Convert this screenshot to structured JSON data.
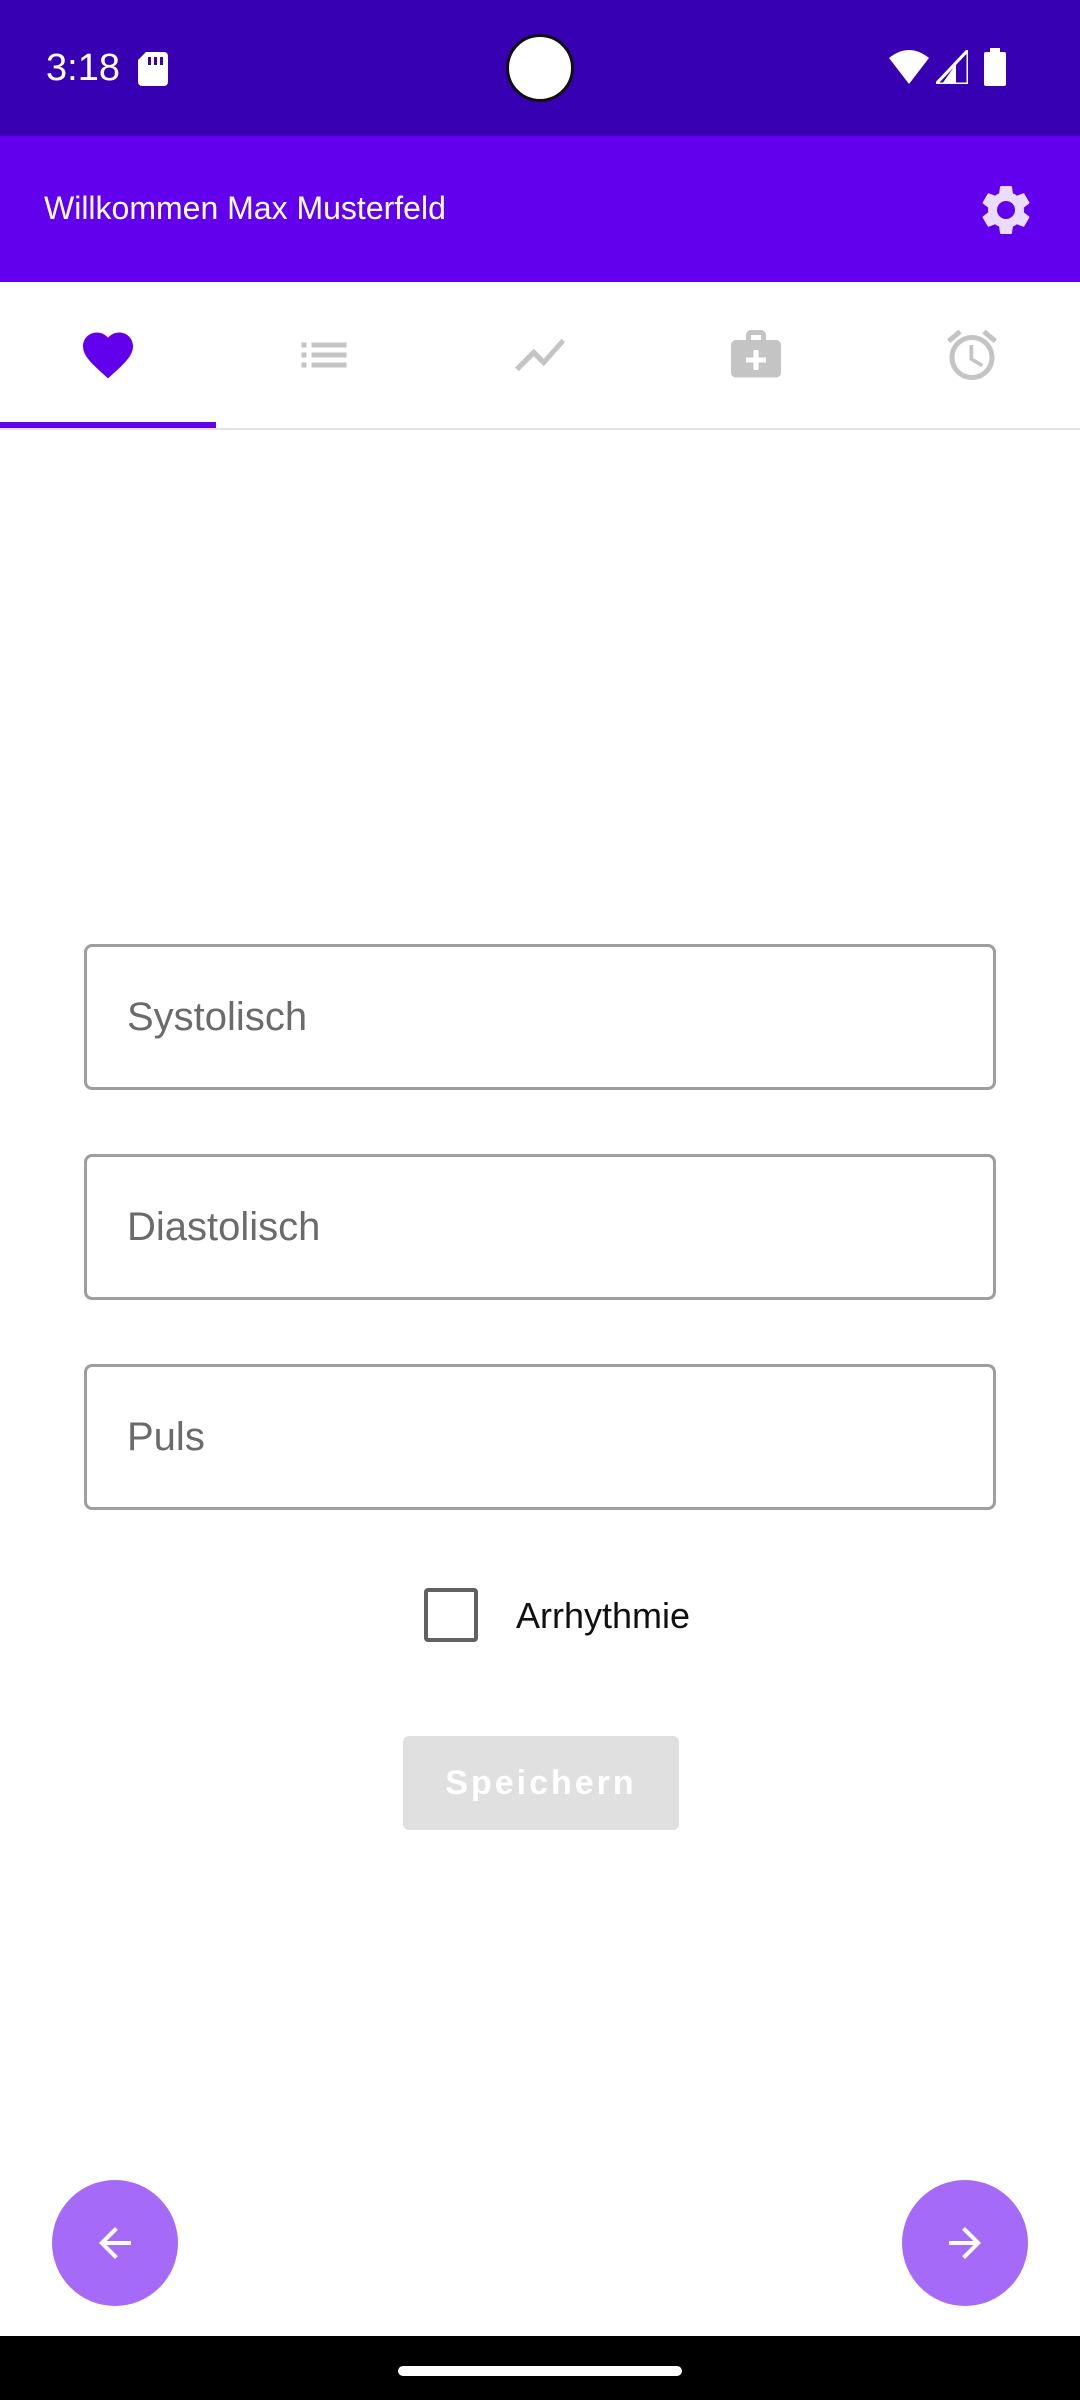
{
  "status_bar": {
    "time": "3:18",
    "icons": [
      "sd-card-icon",
      "wifi-icon",
      "signal-icon",
      "battery-icon"
    ]
  },
  "app_bar": {
    "title": "Willkommen Max Musterfeld",
    "settings_icon": "gear-icon"
  },
  "tabs": {
    "items": [
      {
        "icon": "heart-icon",
        "selected": true
      },
      {
        "icon": "list-icon",
        "selected": false
      },
      {
        "icon": "trending-icon",
        "selected": false
      },
      {
        "icon": "medical-bag-icon",
        "selected": false
      },
      {
        "icon": "alarm-icon",
        "selected": false
      }
    ]
  },
  "form": {
    "systolic": {
      "value": "",
      "placeholder": "Systolisch"
    },
    "diastolic": {
      "value": "",
      "placeholder": "Diastolisch"
    },
    "pulse": {
      "value": "",
      "placeholder": "Puls"
    },
    "arrhythmia": {
      "label": "Arrhythmie",
      "checked": false
    },
    "save_label": "Speichern"
  },
  "navigation": {
    "back_icon": "arrow-left-icon",
    "forward_icon": "arrow-right-icon"
  },
  "colors": {
    "status_bar": "#3700b3",
    "primary": "#6200ee",
    "fab": "#a56af7",
    "tab_inactive": "#c4c4c4",
    "button_disabled": "#e0e0e0"
  }
}
